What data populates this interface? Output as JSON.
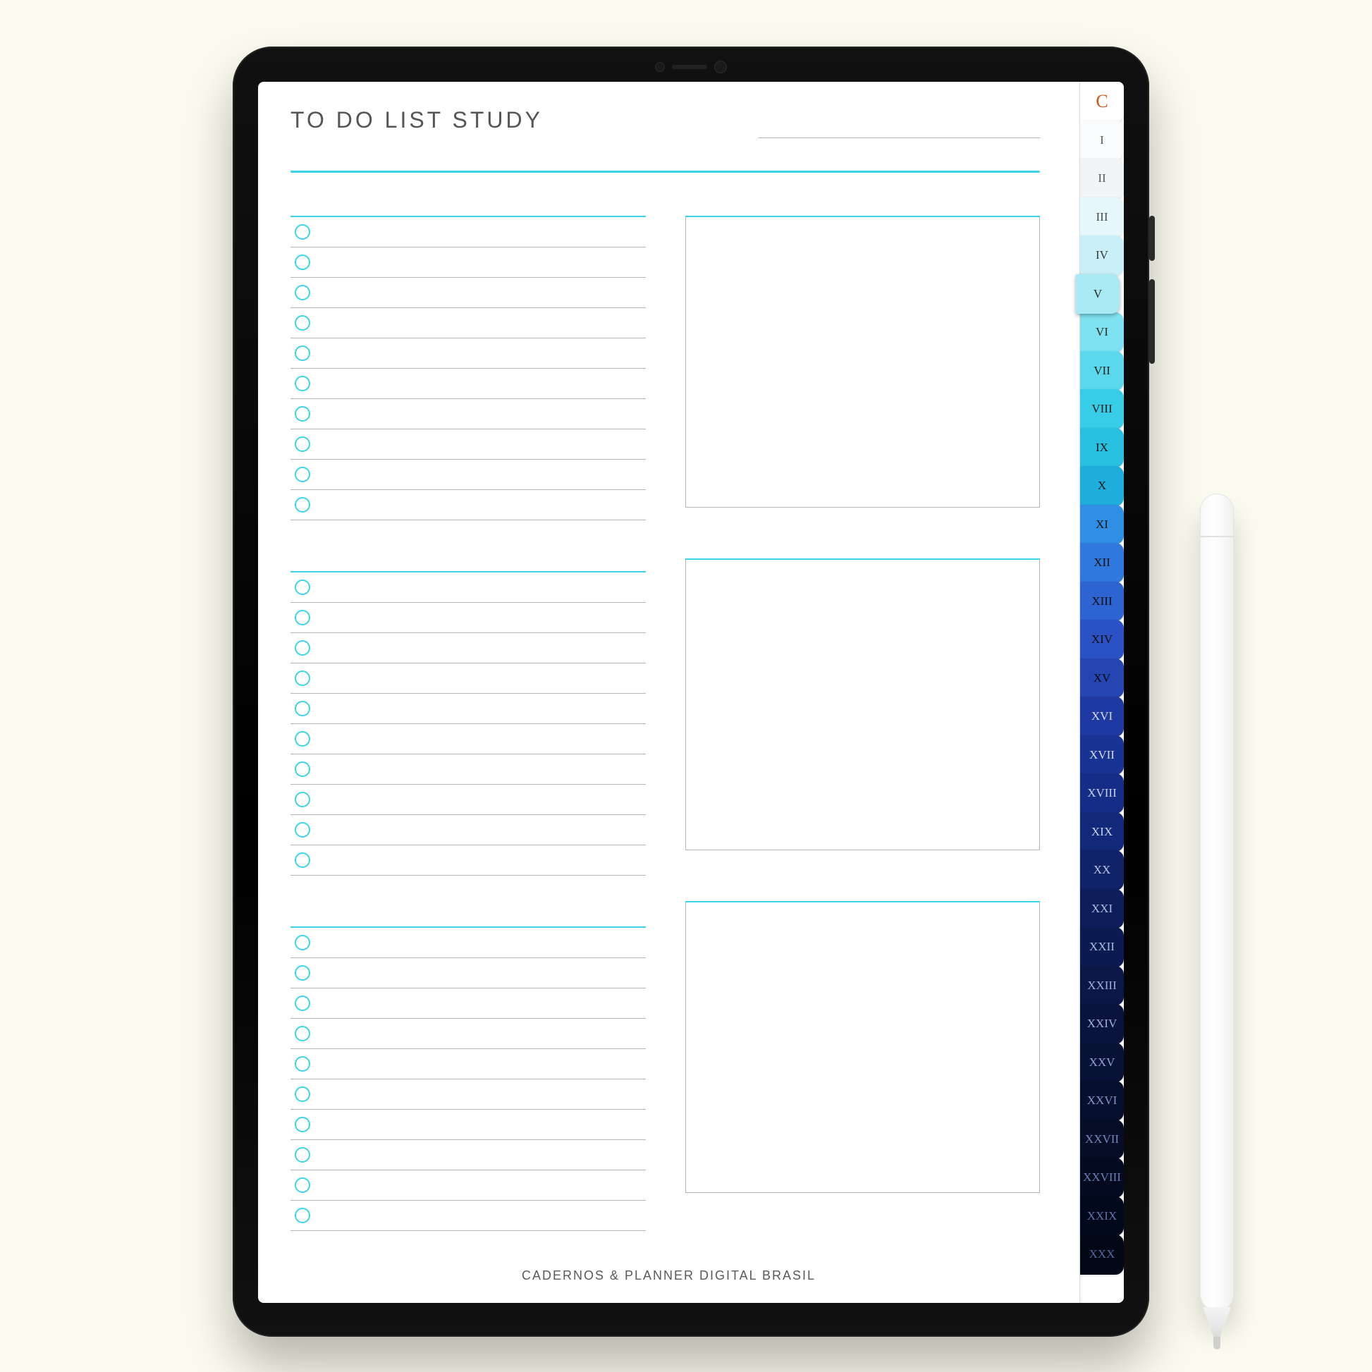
{
  "page": {
    "title": "TO DO LIST STUDY",
    "footer": "CADERNOS & PLANNER DIGITAL BRASIL",
    "date_line": ""
  },
  "checklist_blocks": [
    {
      "header": "",
      "rows": [
        "",
        "",
        "",
        "",
        "",
        "",
        "",
        "",
        "",
        ""
      ]
    },
    {
      "header": "",
      "rows": [
        "",
        "",
        "",
        "",
        "",
        "",
        "",
        "",
        "",
        ""
      ]
    },
    {
      "header": "",
      "rows": [
        "",
        "",
        "",
        "",
        "",
        "",
        "",
        "",
        "",
        ""
      ]
    }
  ],
  "note_blocks": [
    {
      "header": "",
      "body": ""
    },
    {
      "header": "",
      "body": ""
    },
    {
      "header": "",
      "body": ""
    }
  ],
  "tabs": [
    {
      "label": "C",
      "bg": "#FFFFFF",
      "fg": "#C65A1F",
      "logo": true
    },
    {
      "label": "I",
      "bg": "#FAFBFC",
      "fg": "#5a5a5a"
    },
    {
      "label": "II",
      "bg": "#F2F5F7",
      "fg": "#5a5a5a"
    },
    {
      "label": "III",
      "bg": "#E6F7FB",
      "fg": "#4a4a4a"
    },
    {
      "label": "IV",
      "bg": "#C9F0F8",
      "fg": "#3a3a3a"
    },
    {
      "label": "V",
      "bg": "#A7EAF4",
      "fg": "#2c2c2c"
    },
    {
      "label": "VI",
      "bg": "#7FE2F0",
      "fg": "#2c2c2c"
    },
    {
      "label": "VII",
      "bg": "#5BD8EC",
      "fg": "#222"
    },
    {
      "label": "VIII",
      "bg": "#38CDE7",
      "fg": "#1b1b1b"
    },
    {
      "label": "IX",
      "bg": "#29BFE0",
      "fg": "#1b1b1b"
    },
    {
      "label": "X",
      "bg": "#1FAEDB",
      "fg": "#151515"
    },
    {
      "label": "XI",
      "bg": "#2E8FE5",
      "fg": "#151515"
    },
    {
      "label": "XII",
      "bg": "#2F78DD",
      "fg": "#101010"
    },
    {
      "label": "XIII",
      "bg": "#2E63D2",
      "fg": "#0e0e0e"
    },
    {
      "label": "XIV",
      "bg": "#2B52C4",
      "fg": "#0c0c0c"
    },
    {
      "label": "XV",
      "bg": "#2545B3",
      "fg": "#0a0a0a"
    },
    {
      "label": "XVI",
      "bg": "#1E3AA2",
      "fg": "#d8def0"
    },
    {
      "label": "XVII",
      "bg": "#193395",
      "fg": "#d8def0"
    },
    {
      "label": "XVIII",
      "bg": "#152D87",
      "fg": "#c9d2ec"
    },
    {
      "label": "XIX",
      "bg": "#122878",
      "fg": "#c9d2ec"
    },
    {
      "label": "XX",
      "bg": "#102369",
      "fg": "#bac5e6"
    },
    {
      "label": "XXI",
      "bg": "#0D1E5B",
      "fg": "#aebbe0"
    },
    {
      "label": "XXII",
      "bg": "#0B1A50",
      "fg": "#aebbe0"
    },
    {
      "label": "XXIII",
      "bg": "#0A1747",
      "fg": "#9fafda"
    },
    {
      "label": "XXIV",
      "bg": "#08143E",
      "fg": "#9fafda"
    },
    {
      "label": "XXV",
      "bg": "#071236",
      "fg": "#90a2d2"
    },
    {
      "label": "XXVI",
      "bg": "#060F2E",
      "fg": "#8395c9"
    },
    {
      "label": "XXVII",
      "bg": "#050D27",
      "fg": "#7589c0"
    },
    {
      "label": "XXVIII",
      "bg": "#040B21",
      "fg": "#6a7eb6"
    },
    {
      "label": "XXIX",
      "bg": "#03091C",
      "fg": "#5f73ab"
    },
    {
      "label": "XXX",
      "bg": "#030817",
      "fg": "#54689f"
    }
  ],
  "selected_tab_index": 5,
  "colors": {
    "accent": "#3CD4E6",
    "rule": "#B5B6BA"
  }
}
